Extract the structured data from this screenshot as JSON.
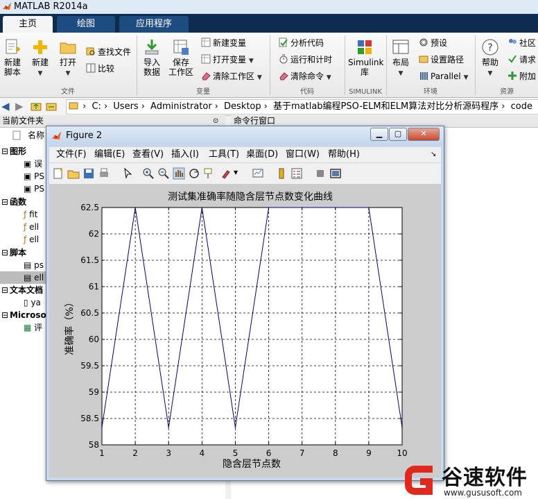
{
  "app": {
    "title": "MATLAB R2014a"
  },
  "tabs": [
    {
      "label": "主页"
    },
    {
      "label": "绘图"
    },
    {
      "label": "应用程序"
    }
  ],
  "ribbon": {
    "file": {
      "new_script": "新建\n脚本",
      "new": "新建",
      "open": "打开",
      "find_files": "查找文件",
      "compare": "比较",
      "group": "文件"
    },
    "variable": {
      "import": "导入\n数据",
      "save_ws": "保存\n工作区",
      "new_var": "新建变量",
      "open_var": "打开变量",
      "clear_ws": "清除工作区",
      "group": "变量"
    },
    "code": {
      "analyze": "分析代码",
      "run_time": "运行和计时",
      "clear_cmd": "清除命令",
      "group": "代码"
    },
    "simulink": {
      "lib": "Simulink\n库",
      "group": "SIMULINK"
    },
    "env": {
      "layout": "布局",
      "prefs": "预设",
      "set_path": "设置路径",
      "parallel": "Parallel",
      "group": "环境"
    },
    "res": {
      "help": "帮助",
      "community": "社区",
      "request": "请求",
      "addons": "附加",
      "group": "资源"
    }
  },
  "address": {
    "path": [
      "C:",
      "Users",
      "Administrator",
      "Desktop",
      "基于matlab编程PSO-ELM和ELM算法对比分析源码程序",
      "code"
    ]
  },
  "left_panel": {
    "title": "当前文件夹",
    "col_name": "名称",
    "groups": [
      {
        "label": "图形",
        "items": [
          "误",
          "PS",
          "PS"
        ]
      },
      {
        "label": "函数",
        "items": [
          "fit",
          "ell",
          "ell"
        ]
      },
      {
        "label": "脚本",
        "items": [
          "ps",
          "ell"
        ]
      },
      {
        "label": "文本文档",
        "items": [
          "ya"
        ]
      },
      {
        "label": "Microso",
        "items": [
          "评"
        ]
      }
    ]
  },
  "command_window": {
    "title": "命令行窗口"
  },
  "figure": {
    "title": "Figure 2",
    "menu": [
      "文件(F)",
      "编辑(E)",
      "查看(V)",
      "插入(I)",
      "工具(T)",
      "桌面(D)",
      "窗口(W)",
      "帮助(H)"
    ]
  },
  "chart_data": {
    "type": "line",
    "title": "测试集准确率随隐含层节点数变化曲线",
    "xlabel": "隐含层节点数",
    "ylabel": "准确率（%）",
    "x": [
      1,
      2,
      3,
      4,
      5,
      6,
      7,
      8,
      9,
      10
    ],
    "series": [
      {
        "values": [
          58.33,
          62.5,
          58.33,
          62.5,
          58.33,
          62.5,
          62.5,
          62.5,
          62.5,
          58.33
        ],
        "color": "#00007f"
      }
    ],
    "xlim": [
      1,
      10
    ],
    "ylim": [
      58,
      62.5
    ],
    "xticks": [
      1,
      2,
      3,
      4,
      5,
      6,
      7,
      8,
      9,
      10
    ],
    "yticks": [
      58,
      58.5,
      59,
      59.5,
      60,
      60.5,
      61,
      61.5,
      62,
      62.5
    ],
    "grid": true
  },
  "watermark": {
    "brand": "谷速软件",
    "url": "www.gususoft.com"
  },
  "colors": {
    "tab_bar": "#0e2c4f",
    "tab": "#1d4c80",
    "plot_line": "#00007f"
  }
}
